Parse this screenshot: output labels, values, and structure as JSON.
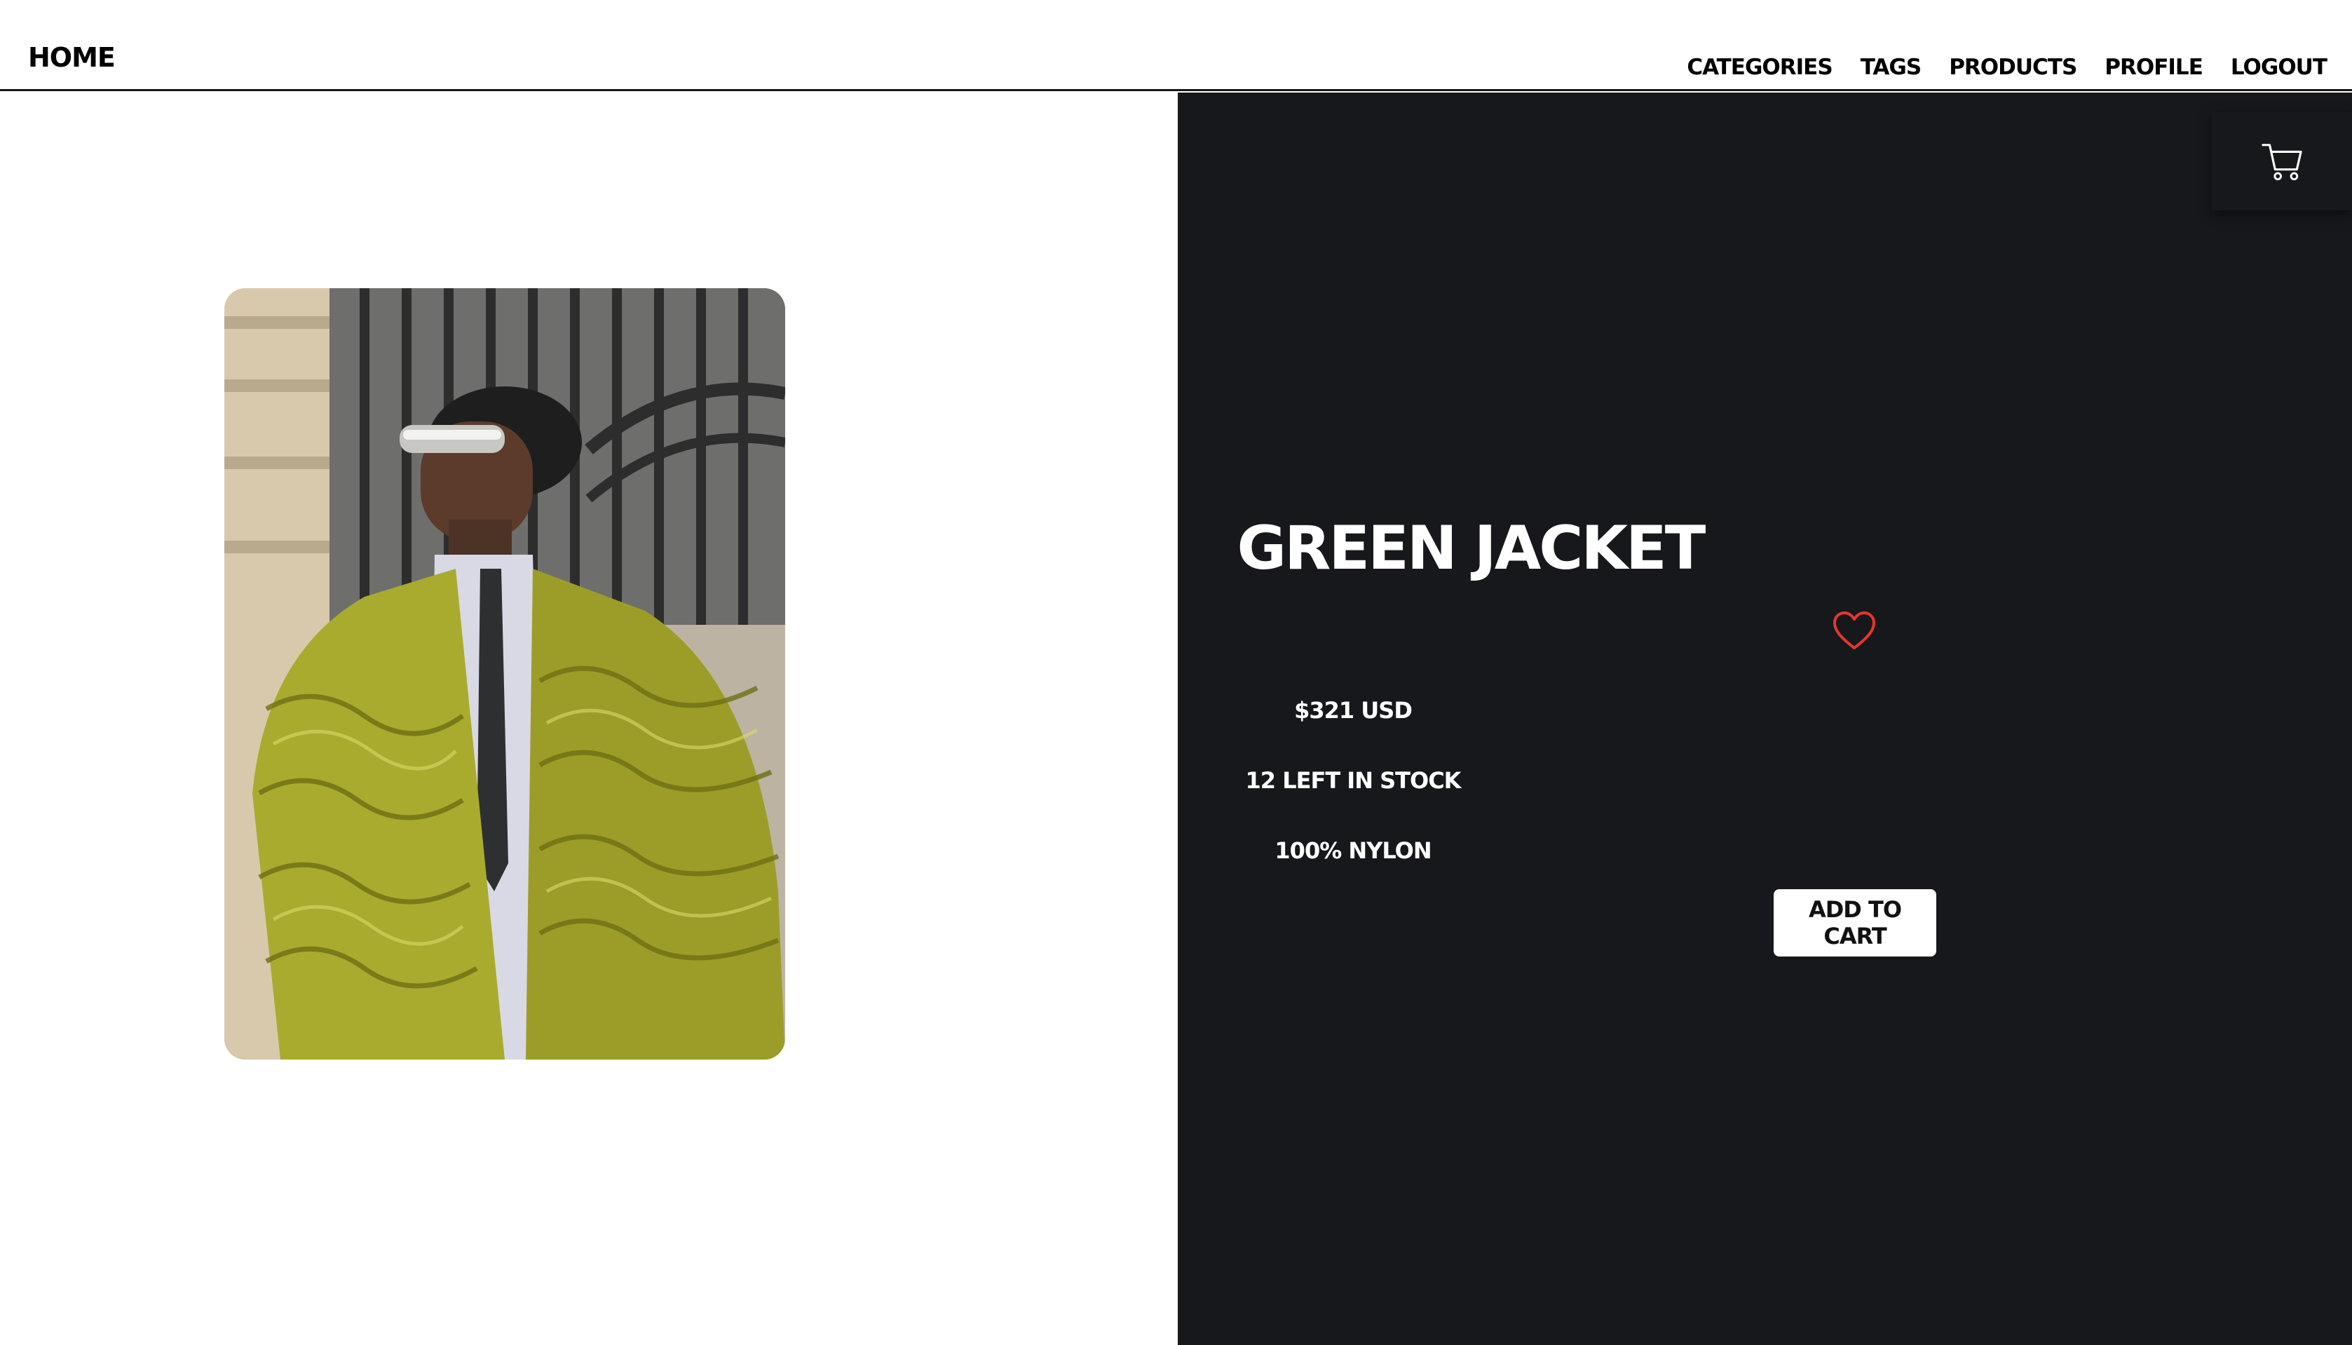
{
  "header": {
    "home_label": "HOME",
    "nav_items": [
      {
        "label": "CATEGORIES"
      },
      {
        "label": "TAGS"
      },
      {
        "label": "PRODUCTS"
      },
      {
        "label": "PROFILE"
      },
      {
        "label": "LOGOUT"
      }
    ]
  },
  "cart": {
    "icon": "cart-icon"
  },
  "product": {
    "image_icon": "product-photo",
    "title": "GREEN JACKET",
    "favorite_icon": "heart-icon",
    "price": "$321 USD",
    "stock": "12 LEFT IN STOCK",
    "material": "100% NYLON",
    "add_to_cart_label": "ADD TO CART"
  },
  "colors": {
    "dark_panel": "#17181c",
    "heart": "#e8362c",
    "accent_jacket": "#a8ab2c"
  }
}
